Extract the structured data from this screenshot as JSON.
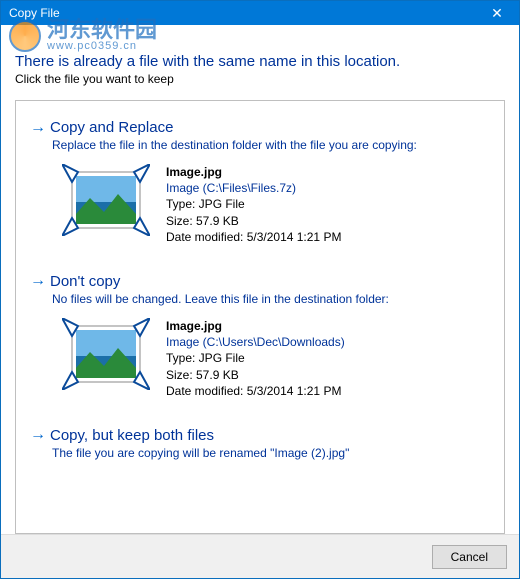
{
  "titlebar": {
    "title": "Copy File"
  },
  "watermark": {
    "main": "河东软件园",
    "sub": "www.pc0359.cn"
  },
  "header": {
    "headline": "There is already a file with the same name in this location.",
    "subhead": "Click the file you want to keep"
  },
  "options": [
    {
      "title": "Copy and Replace",
      "desc": "Replace the file in the destination folder with the file you are copying:",
      "file": {
        "name": "Image.jpg",
        "path": "Image (C:\\Files\\Files.7z)",
        "type": "Type: JPG File",
        "size": "Size: 57.9 KB",
        "modified": "Date modified: 5/3/2014 1:21 PM"
      }
    },
    {
      "title": "Don't copy",
      "desc": "No files will be changed. Leave this file in the destination folder:",
      "file": {
        "name": "Image.jpg",
        "path": "Image (C:\\Users\\Dec\\Downloads)",
        "type": "Type: JPG File",
        "size": "Size: 57.9 KB",
        "modified": "Date modified: 5/3/2014 1:21 PM"
      }
    },
    {
      "title": "Copy, but keep both files",
      "desc": "The file you are copying will be renamed \"Image (2).jpg\""
    }
  ],
  "footer": {
    "cancel": "Cancel"
  }
}
